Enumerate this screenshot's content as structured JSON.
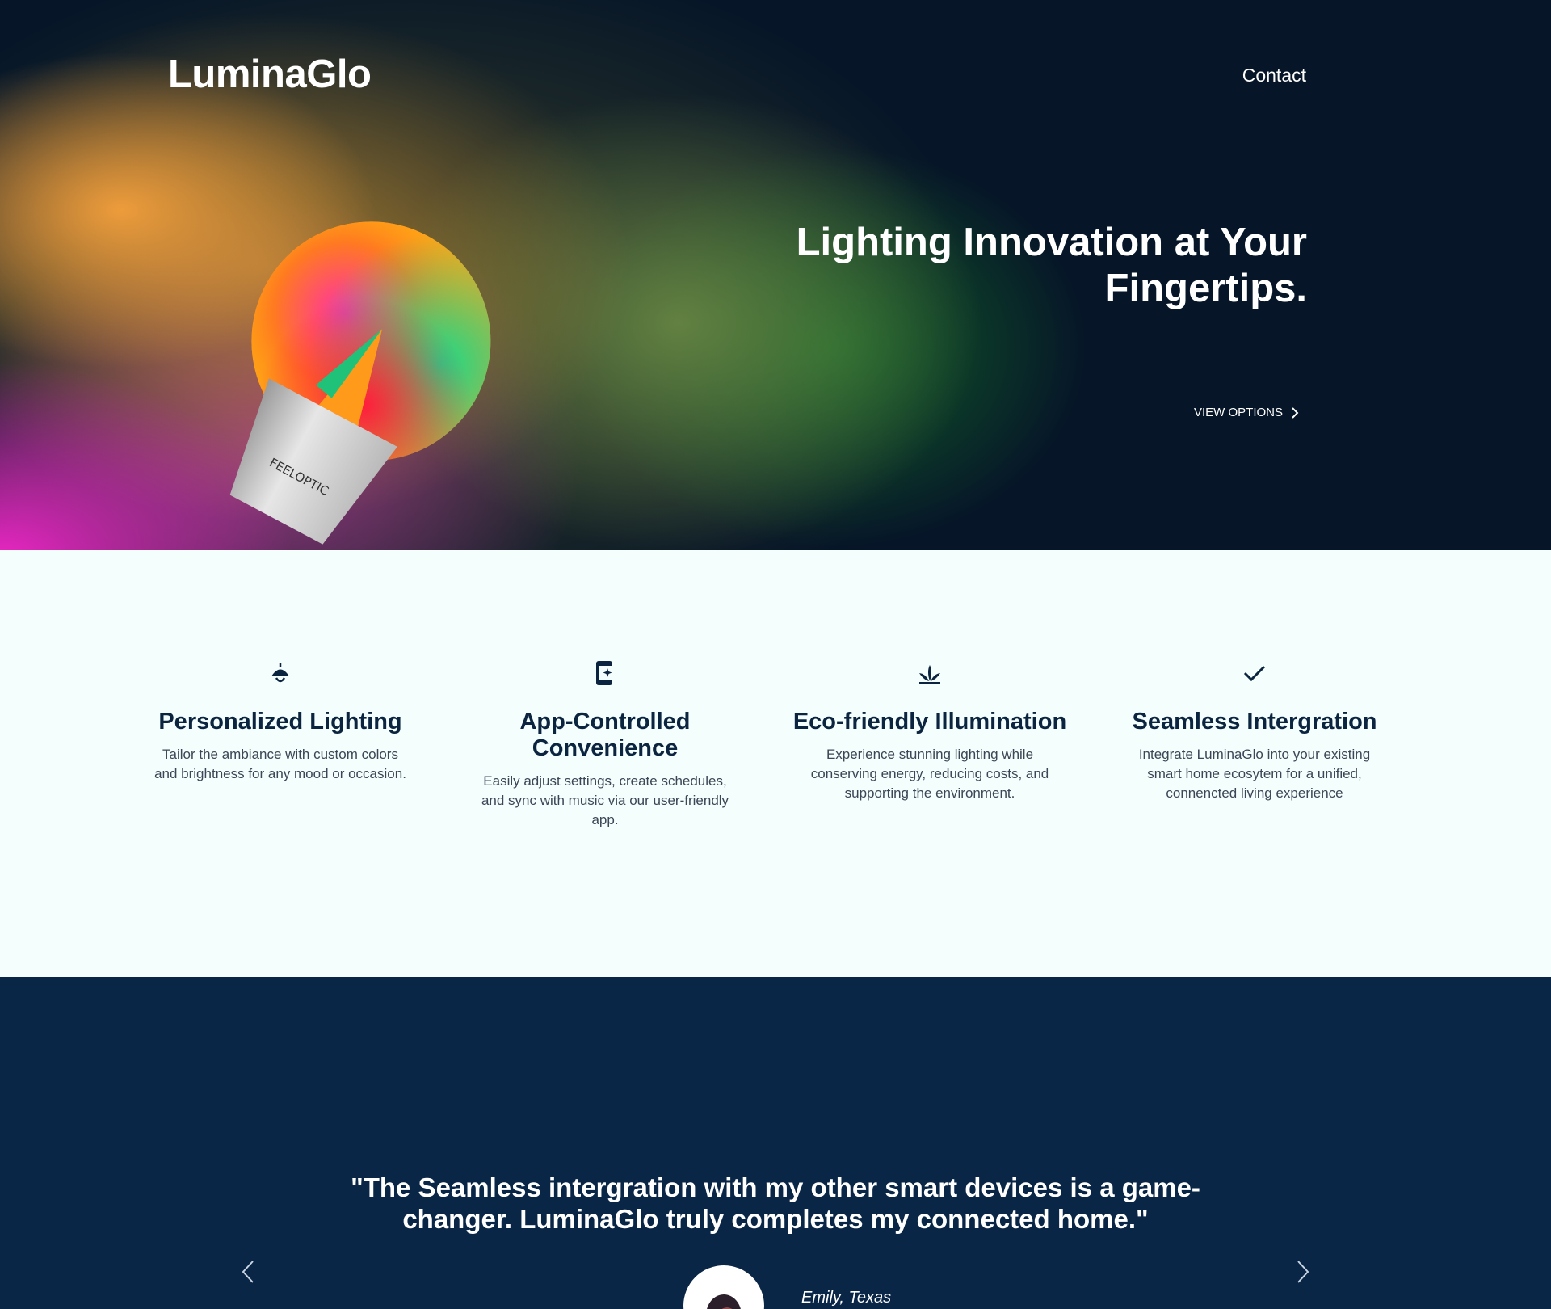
{
  "header": {
    "brand": "LuminaGlo",
    "nav_contact": "Contact"
  },
  "hero": {
    "title": "Lighting Innovation at Your Fingertips.",
    "cta_label": "VIEW OPTIONS",
    "bulb_text": "FEELOPTIC"
  },
  "features": [
    {
      "icon": "pendant-lamp-icon",
      "title": "Personalized Lighting",
      "description": "Tailor the ambiance with custom colors and brightness for any mood or occasion."
    },
    {
      "icon": "smartphone-sparkle-icon",
      "title": "App-Controlled Convenience",
      "description": "Easily adjust settings, create schedules, and sync with music via our user-friendly app."
    },
    {
      "icon": "leaf-plant-icon",
      "title": "Eco-friendly Illumination",
      "description": "Experience stunning lighting while conserving energy, reducing costs, and supporting the environment."
    },
    {
      "icon": "checkmark-icon",
      "title": "Seamless Intergration",
      "description": "Integrate LuminaGlo into your existing smart home ecosytem for a unified, connencted living experience"
    }
  ],
  "testimonial": {
    "quote": "\"The Seamless intergration with my other smart devices is a game-changer. LuminaGlo truly completes my connected home.\"",
    "author": "Emily, Texas"
  },
  "colors": {
    "hero_bg": "#061628",
    "features_bg": "#f4fefd",
    "testimonial_bg": "#0a2647",
    "heading_dark": "#0b2440",
    "text_white": "#ffffff"
  }
}
